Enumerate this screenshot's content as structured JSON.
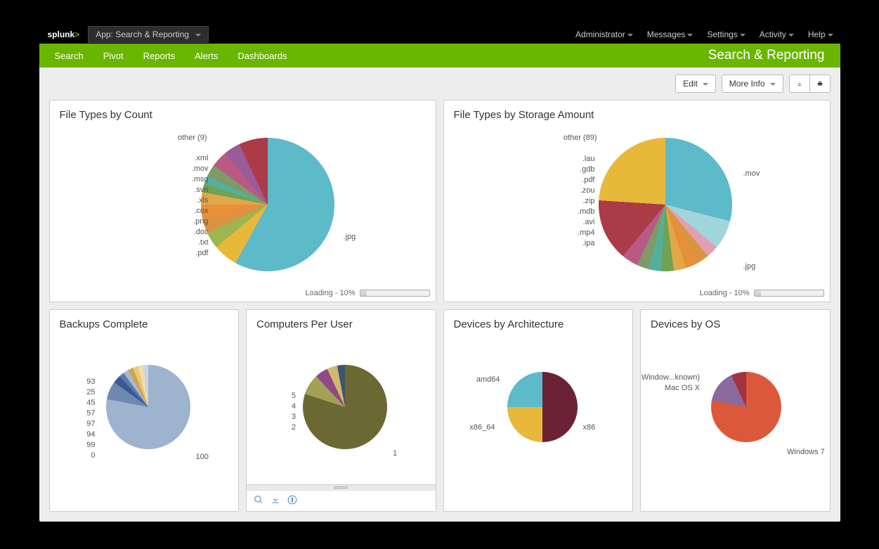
{
  "topbar": {
    "logo": "splunk",
    "app_selector": "App: Search & Reporting",
    "items": [
      "Administrator",
      "Messages",
      "Settings",
      "Activity",
      "Help"
    ]
  },
  "greenbar": {
    "nav": [
      "Search",
      "Pivot",
      "Reports",
      "Alerts",
      "Dashboards"
    ],
    "title": "Search & Reporting"
  },
  "toolbar": {
    "edit": "Edit",
    "more_info": "More Info"
  },
  "panels": {
    "p1": {
      "title": "File Types by Count",
      "loading": "Loading - 10%"
    },
    "p2": {
      "title": "File Types by Storage Amount",
      "loading": "Loading - 10%"
    },
    "p3": {
      "title": "Backups Complete"
    },
    "p4": {
      "title": "Computers Per User"
    },
    "p5": {
      "title": "Devices by Architecture"
    },
    "p6": {
      "title": "Devices by OS"
    }
  },
  "chart_data": [
    {
      "id": "file-types-by-count",
      "type": "pie",
      "title": "File Types by Count",
      "series": [
        {
          "name": ".jpg",
          "value": 58
        },
        {
          "name": ".pdf",
          "value": 6
        },
        {
          "name": ".txt",
          "value": 4
        },
        {
          "name": ".doc",
          "value": 3
        },
        {
          "name": ".png",
          "value": 4
        },
        {
          "name": ".cox",
          "value": 3
        },
        {
          "name": ".xls",
          "value": 2
        },
        {
          "name": ".svn",
          "value": 2
        },
        {
          "name": ".msg",
          "value": 3
        },
        {
          "name": ".mov",
          "value": 4
        },
        {
          "name": ".xml",
          "value": 4
        },
        {
          "name": "other (9)",
          "value": 7
        }
      ]
    },
    {
      "id": "file-types-by-storage",
      "type": "pie",
      "title": "File Types by Storage Amount",
      "series": [
        {
          "name": ".jpg",
          "value": 29
        },
        {
          "name": ".mov",
          "value": 24
        },
        {
          "name": ".ipa",
          "value": 7
        },
        {
          "name": ".mp4",
          "value": 3
        },
        {
          "name": ".avi",
          "value": 3
        },
        {
          "name": ".mdb",
          "value": 3
        },
        {
          "name": ".zip",
          "value": 3
        },
        {
          "name": ".zou",
          "value": 3
        },
        {
          "name": ".pdf",
          "value": 3
        },
        {
          "name": ".gdb",
          "value": 3
        },
        {
          "name": ".lau",
          "value": 4
        },
        {
          "name": "other (89)",
          "value": 15
        }
      ]
    },
    {
      "id": "backups-complete",
      "type": "pie",
      "title": "Backups Complete",
      "series": [
        {
          "name": "100",
          "value": 78
        },
        {
          "name": "0",
          "value": 7
        },
        {
          "name": "99",
          "value": 3
        },
        {
          "name": "94",
          "value": 2
        },
        {
          "name": "97",
          "value": 2
        },
        {
          "name": "57",
          "value": 2
        },
        {
          "name": "45",
          "value": 2
        },
        {
          "name": "25",
          "value": 2
        },
        {
          "name": "93",
          "value": 2
        }
      ]
    },
    {
      "id": "computers-per-user",
      "type": "pie",
      "title": "Computers Per User",
      "series": [
        {
          "name": "1",
          "value": 80
        },
        {
          "name": "2",
          "value": 8
        },
        {
          "name": "3",
          "value": 5
        },
        {
          "name": "4",
          "value": 4
        },
        {
          "name": "5",
          "value": 3
        }
      ]
    },
    {
      "id": "devices-by-architecture",
      "type": "pie",
      "title": "Devices by Architecture",
      "series": [
        {
          "name": "x86",
          "value": 50
        },
        {
          "name": "amd64",
          "value": 25
        },
        {
          "name": "x86_64",
          "value": 25
        }
      ]
    },
    {
      "id": "devices-by-os",
      "type": "pie",
      "title": "Devices by OS",
      "series": [
        {
          "name": "Windows 7",
          "value": 78
        },
        {
          "name": "Mac OS X",
          "value": 15
        },
        {
          "name": "Window...known)",
          "value": 7
        }
      ]
    }
  ]
}
